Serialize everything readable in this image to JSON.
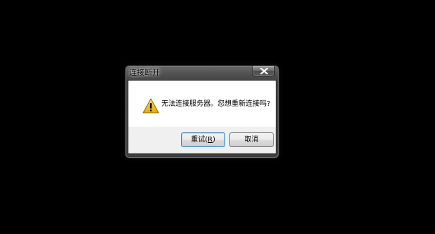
{
  "dialog": {
    "title": "连接断开",
    "message": "无法连接服务器。您想重新连接吗?",
    "icon": "warning-icon",
    "buttons": {
      "retry_label": "重试(",
      "retry_mnemonic": "R",
      "retry_suffix": ")",
      "cancel_label": "取消"
    },
    "close_icon": "close-icon"
  },
  "colors": {
    "desktop_bg": "#000000",
    "frame": "#454545",
    "warning_yellow": "#f2c318",
    "default_button_border": "#3c7fb1"
  }
}
